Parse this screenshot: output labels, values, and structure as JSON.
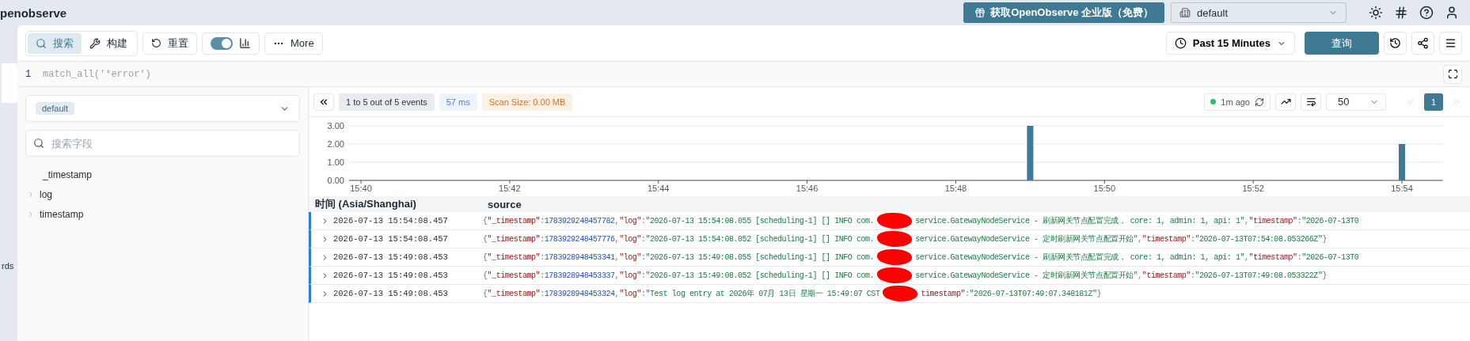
{
  "app": {
    "title": "penobserve"
  },
  "header": {
    "upgrade_button": "获取OpenObserve 企业版（免费）",
    "org_select": {
      "value": "default"
    }
  },
  "sidebar": {
    "items": [
      {
        "label": "rds"
      }
    ]
  },
  "toolbar": {
    "tabs": [
      {
        "label": "搜索",
        "selected": true
      },
      {
        "label": "构建",
        "selected": false
      }
    ],
    "reset_button": "重置",
    "histogram_toggle": {
      "on": true
    },
    "more_button": "More",
    "time_range": "Past 15 Minutes",
    "run_button": "查询"
  },
  "editor": {
    "lines": [
      {
        "number": "1",
        "code": "match_all('*error')"
      }
    ]
  },
  "fields_panel": {
    "stream": "default",
    "search": {
      "placeholder": "搜索字段"
    },
    "fields": [
      {
        "name": "_timestamp",
        "kind": "leaf"
      },
      {
        "name": "log",
        "kind": "group"
      },
      {
        "name": "timestamp",
        "kind": "group"
      }
    ]
  },
  "results": {
    "summary": "1 to 5 out of 5 events",
    "took": "57 ms",
    "scan_size": "Scan Size: 0.00 MB",
    "refreshed": "1m ago",
    "page_size": "50",
    "pages": [
      {
        "label": "1",
        "selected": true
      }
    ],
    "chart_data": {
      "type": "bar",
      "categories": [
        "15:40",
        null,
        "15:42",
        null,
        "15:44",
        null,
        "15:46",
        null,
        "15:48",
        null,
        "15:50",
        null,
        "15:52",
        null,
        "15:54"
      ],
      "values": [
        null,
        null,
        null,
        null,
        null,
        null,
        null,
        null,
        null,
        3,
        null,
        null,
        null,
        null,
        2
      ],
      "ylim": [
        0,
        3
      ],
      "yticks": [
        {
          "value": 0,
          "label": "0.00"
        },
        {
          "value": 1,
          "label": "1.00"
        },
        {
          "value": 2,
          "label": "2.00"
        },
        {
          "value": 3,
          "label": "3.00"
        }
      ]
    },
    "columns": [
      "时间 (Asia/Shanghai)",
      "source"
    ],
    "rows": [
      {
        "time": "2026-07-13 15:54:08.457",
        "expanded": false,
        "source": [
          {
            "kind": "p",
            "text": "{"
          },
          {
            "kind": "k",
            "text": "\"_timestamp\""
          },
          {
            "kind": "p",
            "text": ":"
          },
          {
            "kind": "n",
            "text": "1783929248457782"
          },
          {
            "kind": "p",
            "text": ","
          },
          {
            "kind": "k",
            "text": "\"log\""
          },
          {
            "kind": "p",
            "text": ":"
          },
          {
            "kind": "s",
            "text": "\"2026-07-13 15:54:08.055 [scheduling-1] [] INFO com."
          },
          {
            "kind": "r"
          },
          {
            "kind": "s",
            "text": "service.GatewayNodeService - 刷新网关节点配置完成， core: 1, admin: 1, api: 1\""
          },
          {
            "kind": "p",
            "text": ","
          },
          {
            "kind": "k",
            "text": "\"timestamp\""
          },
          {
            "kind": "p",
            "text": ":"
          },
          {
            "kind": "s",
            "text": "\"2026-07-13T0"
          }
        ]
      },
      {
        "time": "2026-07-13 15:54:08.457",
        "expanded": false,
        "source": [
          {
            "kind": "p",
            "text": "{"
          },
          {
            "kind": "k",
            "text": "\"_timestamp\""
          },
          {
            "kind": "p",
            "text": ":"
          },
          {
            "kind": "n",
            "text": "1783929248457776"
          },
          {
            "kind": "p",
            "text": ","
          },
          {
            "kind": "k",
            "text": "\"log\""
          },
          {
            "kind": "p",
            "text": ":"
          },
          {
            "kind": "s",
            "text": "\"2026-07-13 15:54:08.052 [scheduling-1] [] INFO com."
          },
          {
            "kind": "r"
          },
          {
            "kind": "s",
            "text": "service.GatewayNodeService - 定时刷新网关节点配置开始\""
          },
          {
            "kind": "p",
            "text": ","
          },
          {
            "kind": "k",
            "text": "\"timestamp\""
          },
          {
            "kind": "p",
            "text": ":"
          },
          {
            "kind": "s",
            "text": "\"2026-07-13T07:54:08.053266Z\""
          },
          {
            "kind": "p",
            "text": "}"
          }
        ]
      },
      {
        "time": "2026-07-13 15:49:08.453",
        "expanded": false,
        "source": [
          {
            "kind": "p",
            "text": "{"
          },
          {
            "kind": "k",
            "text": "\"_timestamp\""
          },
          {
            "kind": "p",
            "text": ":"
          },
          {
            "kind": "n",
            "text": "1783928948453341"
          },
          {
            "kind": "p",
            "text": ","
          },
          {
            "kind": "k",
            "text": "\"log\""
          },
          {
            "kind": "p",
            "text": ":"
          },
          {
            "kind": "s",
            "text": "\"2026-07-13 15:49:08.055 [scheduling-1] [] INFO com."
          },
          {
            "kind": "r"
          },
          {
            "kind": "s",
            "text": "service.GatewayNodeService - 刷新网关节点配置完成， core: 1, admin: 1, api: 1\""
          },
          {
            "kind": "p",
            "text": ","
          },
          {
            "kind": "k",
            "text": "\"timestamp\""
          },
          {
            "kind": "p",
            "text": ":"
          },
          {
            "kind": "s",
            "text": "\"2026-07-13T0"
          }
        ]
      },
      {
        "time": "2026-07-13 15:49:08.453",
        "expanded": false,
        "source": [
          {
            "kind": "p",
            "text": "{"
          },
          {
            "kind": "k",
            "text": "\"_timestamp\""
          },
          {
            "kind": "p",
            "text": ":"
          },
          {
            "kind": "n",
            "text": "1783928948453337"
          },
          {
            "kind": "p",
            "text": ","
          },
          {
            "kind": "k",
            "text": "\"log\""
          },
          {
            "kind": "p",
            "text": ":"
          },
          {
            "kind": "s",
            "text": "\"2026-07-13 15:49:08.052 [scheduling-1] [] INFO com."
          },
          {
            "kind": "r"
          },
          {
            "kind": "s",
            "text": "service.GatewayNodeService - 定时刷新网关节点配置开始\""
          },
          {
            "kind": "p",
            "text": ","
          },
          {
            "kind": "k",
            "text": "\"timestamp\""
          },
          {
            "kind": "p",
            "text": ":"
          },
          {
            "kind": "s",
            "text": "\"2026-07-13T07:49:08.053322Z\""
          },
          {
            "kind": "p",
            "text": "}"
          }
        ]
      },
      {
        "time": "2026-07-13 15:49:08.453",
        "expanded": false,
        "source": [
          {
            "kind": "p",
            "text": "{"
          },
          {
            "kind": "k",
            "text": "\"_timestamp\""
          },
          {
            "kind": "p",
            "text": ":"
          },
          {
            "kind": "n",
            "text": "1783928948453324"
          },
          {
            "kind": "p",
            "text": ","
          },
          {
            "kind": "k",
            "text": "\"log\""
          },
          {
            "kind": "p",
            "text": ":"
          },
          {
            "kind": "s",
            "text": "\"Test log entry at 2026年 07月 13日 星期一 15:49:07 CST"
          },
          {
            "kind": "r"
          },
          {
            "kind": "k",
            "text": "timestamp\""
          },
          {
            "kind": "p",
            "text": ":"
          },
          {
            "kind": "s",
            "text": "\"2026-07-13T07:49:07.348181Z\""
          },
          {
            "kind": "p",
            "text": "}"
          }
        ]
      }
    ]
  }
}
